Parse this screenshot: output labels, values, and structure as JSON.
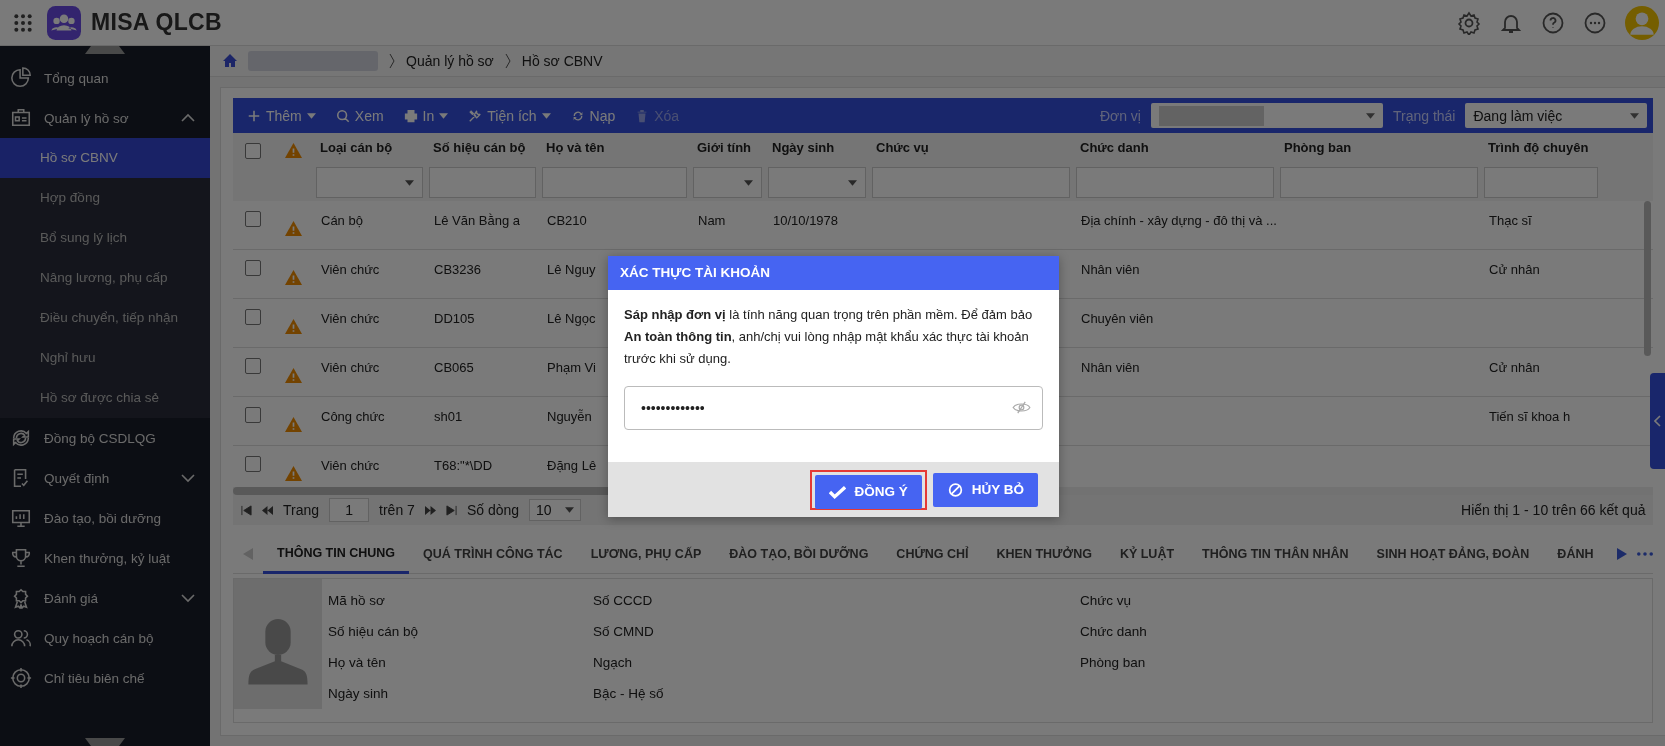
{
  "app": {
    "title": "MISA QLCB"
  },
  "sidebar": {
    "items": [
      {
        "label": "Tổng quan"
      },
      {
        "label": "Quản lý hồ sơ",
        "expanded": true,
        "children": [
          {
            "label": "Hồ sơ CBNV",
            "selected": true
          },
          {
            "label": "Hợp đồng",
            "selected": false
          },
          {
            "label": "Bổ sung lý lịch",
            "selected": false
          },
          {
            "label": "Nâng lương, phụ cấp",
            "selected": false
          },
          {
            "label": "Điều chuyển, tiếp nhận",
            "selected": false
          },
          {
            "label": "Nghỉ hưu",
            "selected": false
          },
          {
            "label": "Hồ sơ được chia sẻ",
            "selected": false
          }
        ]
      },
      {
        "label": "Đồng bộ CSDLQG"
      },
      {
        "label": "Quyết định",
        "expanded": false
      },
      {
        "label": "Đào tạo, bồi dưỡng"
      },
      {
        "label": "Khen thưởng, kỷ luật"
      },
      {
        "label": "Đánh giá",
        "expanded": false
      },
      {
        "label": "Quy hoạch cán bộ"
      },
      {
        "label": "Chỉ tiêu biên chế"
      }
    ]
  },
  "breadcrumb": [
    "Quản lý hồ sơ",
    "Hồ sơ CBNV"
  ],
  "toolbar": {
    "buttons": [
      {
        "label": "Thêm",
        "dropdown": true,
        "disabled": false
      },
      {
        "label": "Xem",
        "dropdown": false,
        "disabled": false
      },
      {
        "label": "In",
        "dropdown": true,
        "disabled": false
      },
      {
        "label": "Tiện ích",
        "dropdown": true,
        "disabled": false
      },
      {
        "label": "Nạp",
        "dropdown": false,
        "disabled": false
      },
      {
        "label": "Xóa",
        "dropdown": false,
        "disabled": true
      }
    ],
    "unit_label": "Đơn vị",
    "status_label": "Trạng thái",
    "status_value": "Đang làm việc"
  },
  "table": {
    "select_all_checked": false,
    "columns": [
      {
        "label": "Loại cán bộ",
        "kind": "dropdown"
      },
      {
        "label": "Số hiệu cán bộ",
        "kind": "text"
      },
      {
        "label": "Họ và tên",
        "kind": "text"
      },
      {
        "label": "Giới tính",
        "kind": "dropdown"
      },
      {
        "label": "Ngày sinh",
        "kind": "dropdown"
      },
      {
        "label": "Chức vụ",
        "kind": "text"
      },
      {
        "label": "Chức danh",
        "kind": "text"
      },
      {
        "label": "Phòng ban",
        "kind": "text"
      },
      {
        "label": "Trình độ chuyên",
        "kind": "text"
      }
    ],
    "rows": [
      {
        "checked": false,
        "c1": "Cán bộ",
        "c2": "Lê Văn Bằng a",
        "c3": "CB210",
        "c4": "Nam",
        "c5": "10/10/1978",
        "c7": "Địa chính - xây dựng - đô thị và ...",
        "c9": "Thạc sĩ"
      },
      {
        "checked": false,
        "c1": "Viên chức",
        "c2": "CB3236",
        "c3": "Lê Nguy",
        "c7": "Nhân viên",
        "c9": "Cử nhân"
      },
      {
        "checked": false,
        "c1": "Viên chức",
        "c2": "DD105",
        "c3": "Lê Ngọc",
        "c7": "Chuyên viên"
      },
      {
        "checked": false,
        "c1": "Viên chức",
        "c2": "CB065",
        "c3": "Phạm Vi",
        "c7": "Nhân viên",
        "c9": "Cử nhân"
      },
      {
        "checked": false,
        "c1": "Công chức",
        "c2": "sh01",
        "c3": "Nguyễn",
        "c9": "Tiến sĩ khoa h"
      },
      {
        "checked": false,
        "c1": "Viên chức",
        "c2": "T68:\"*\\DD",
        "c3": "Đặng Lê"
      }
    ]
  },
  "pagination": {
    "page_label": "Trang",
    "page": "1",
    "of": "trên 7",
    "rows_label": "Số dòng",
    "rows_value": "10",
    "summary": "Hiển thị 1 - 10 trên 66 kết quả"
  },
  "detail_tabs": [
    {
      "label": "THÔNG TIN CHUNG",
      "selected": true
    },
    {
      "label": "QUÁ TRÌNH CÔNG TÁC",
      "selected": false
    },
    {
      "label": "LƯƠNG, PHỤ CẤP",
      "selected": false
    },
    {
      "label": "ĐÀO TẠO, BỒI DƯỠNG",
      "selected": false
    },
    {
      "label": "CHỨNG CHỈ",
      "selected": false
    },
    {
      "label": "KHEN THƯỞNG",
      "selected": false
    },
    {
      "label": "KỶ LUẬT",
      "selected": false
    },
    {
      "label": "THÔNG TIN THÂN NHÂN",
      "selected": false
    },
    {
      "label": "SINH HOẠT ĐẢNG, ĐOÀN",
      "selected": false
    },
    {
      "label": "ĐÁNH",
      "selected": false
    }
  ],
  "detail_fields": [
    [
      "Mã hồ sơ",
      "Số hiệu cán bộ",
      "Họ và tên",
      "Ngày sinh"
    ],
    [
      "Số CCCD",
      "Số CMND",
      "Ngạch",
      "Bậc - Hệ số"
    ],
    [
      "Chức vụ",
      "Chức danh",
      "Phòng ban"
    ]
  ],
  "dialog": {
    "title": "XÁC THỰC TÀI KHOẢN",
    "message": "**Sáp nhập đơn vị** là tính năng quan trọng trên phần mềm. Để đảm bảo **An toàn thông tin**, anh/chị vui lòng nhập mật khẩu xác thực tài khoản trước khi sử dụng.",
    "password": "•••••••••••••",
    "buttons": [
      {
        "label": "ĐỒNG Ý",
        "kind": "confirm",
        "highlighted": true
      },
      {
        "label": "HỦY BỎ",
        "kind": "cancel",
        "highlighted": false
      }
    ]
  }
}
